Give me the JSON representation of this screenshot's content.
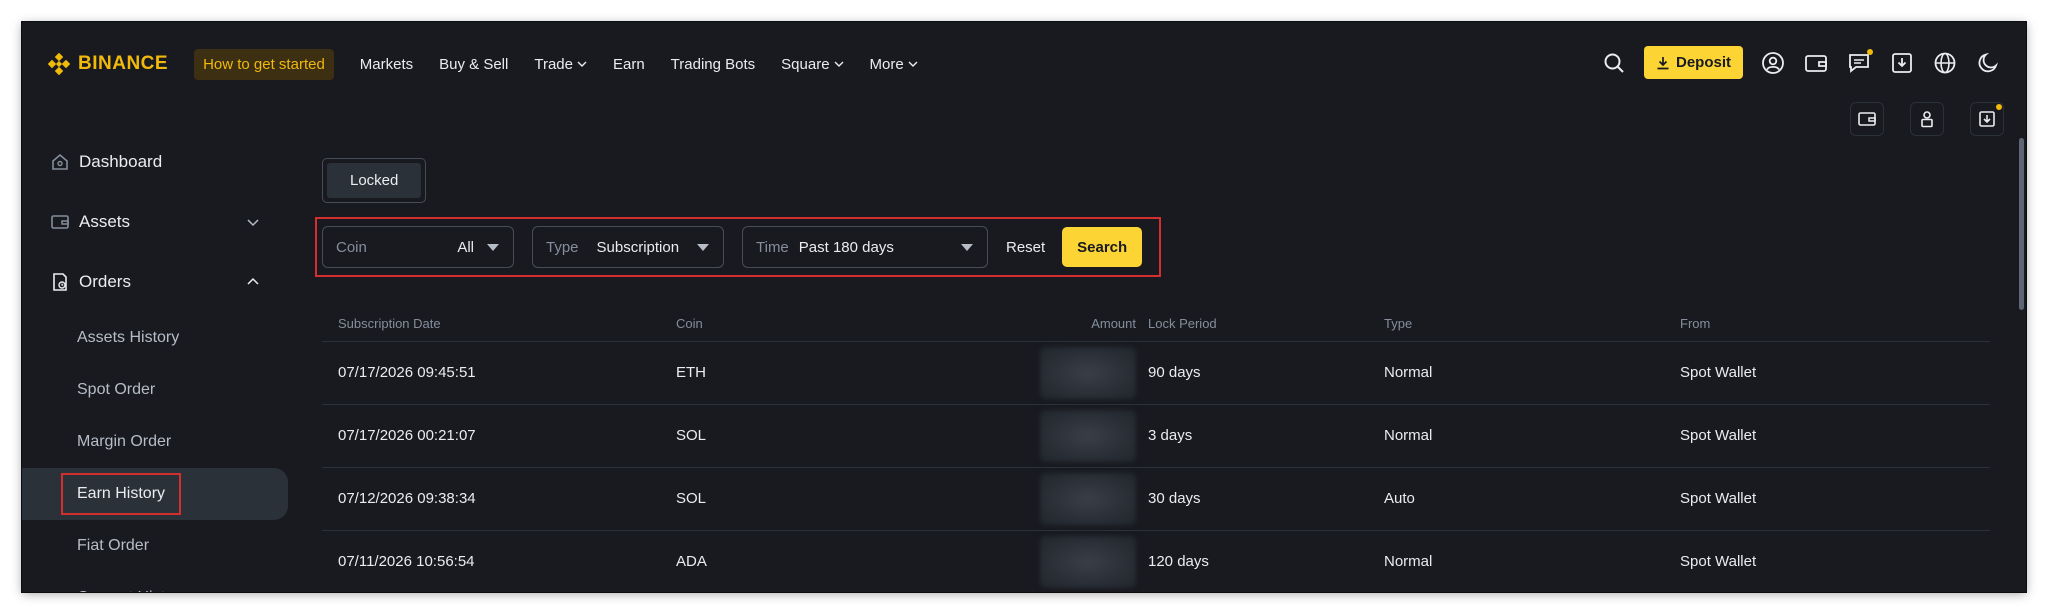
{
  "brand": "BINANCE",
  "nav": {
    "get_started": "How to get started",
    "items": [
      "Markets",
      "Buy & Sell",
      "Trade",
      "Earn",
      "Trading Bots",
      "Square",
      "More"
    ],
    "deposit": "Deposit"
  },
  "sidebar": {
    "dashboard": "Dashboard",
    "assets": "Assets",
    "orders": "Orders",
    "sub": [
      "Assets History",
      "Spot Order",
      "Margin Order",
      "Earn History",
      "Fiat Order",
      "Convert History"
    ]
  },
  "tabs": {
    "locked": "Locked"
  },
  "filters": {
    "coin_label": "Coin",
    "coin_value": "All",
    "type_label": "Type",
    "type_value": "Subscription",
    "time_label": "Time",
    "time_value": "Past 180 days",
    "reset": "Reset",
    "search": "Search"
  },
  "table": {
    "headers": [
      "Subscription Date",
      "Coin",
      "Amount",
      "Lock Period",
      "Type",
      "From"
    ],
    "rows": [
      {
        "date": "07/17/2026 09:45:51",
        "coin": "ETH",
        "lock": "90 days",
        "type": "Normal",
        "from": "Spot Wallet"
      },
      {
        "date": "07/17/2026 00:21:07",
        "coin": "SOL",
        "lock": "3 days",
        "type": "Normal",
        "from": "Spot Wallet"
      },
      {
        "date": "07/12/2026 09:38:34",
        "coin": "SOL",
        "lock": "30 days",
        "type": "Auto",
        "from": "Spot Wallet"
      },
      {
        "date": "07/11/2026 10:56:54",
        "coin": "ADA",
        "lock": "120 days",
        "type": "Normal",
        "from": "Spot Wallet"
      }
    ]
  },
  "colors": {
    "accent": "#fcd535",
    "brand": "#f0b90b",
    "background": "#181a20",
    "highlight": "#d32f2f"
  }
}
